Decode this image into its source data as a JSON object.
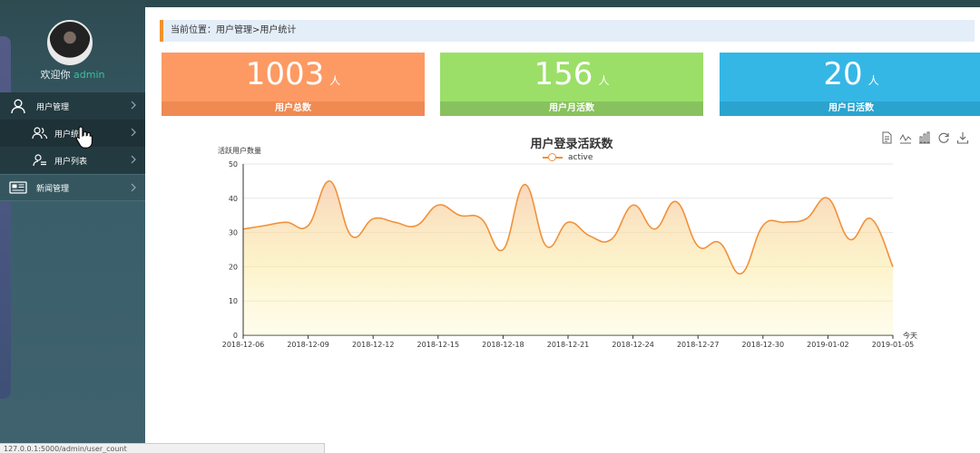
{
  "sidebar": {
    "welcome_prefix": "欢迎你",
    "username": "admin",
    "menu": [
      {
        "label": "用户管理",
        "icon": "user-icon"
      },
      {
        "label": "用户统",
        "icon": "users-icon"
      },
      {
        "label": "用户列表",
        "icon": "user-list-icon"
      },
      {
        "label": "新闻管理",
        "icon": "news-icon"
      }
    ]
  },
  "statusbar": {
    "url": "127.0.0.1:5000/admin/user_count"
  },
  "breadcrumb": {
    "text": "当前位置：用户管理>用户统计"
  },
  "cards": [
    {
      "value": "1003",
      "unit": "人",
      "label": "用户总数",
      "color": "#fd9a63"
    },
    {
      "value": "156",
      "unit": "人",
      "label": "用户月活数",
      "color": "#9bdf68"
    },
    {
      "value": "20",
      "unit": "人",
      "label": "用户日活数",
      "color": "#35b7e6"
    }
  ],
  "toolbox": [
    "data-view-icon",
    "line-switch-icon",
    "bar-switch-icon",
    "restore-icon",
    "download-icon"
  ],
  "chart_data": {
    "type": "area",
    "title": "用户登录活跃数",
    "ylabel": "活跃用户数量",
    "xlabel": "今天",
    "ylim": [
      0,
      50
    ],
    "yticks": [
      0,
      10,
      20,
      30,
      40,
      50
    ],
    "legend": "top-center",
    "grid": true,
    "color": "#f1913a",
    "x_tick_labels": [
      "2018-12-06",
      "2018-12-09",
      "2018-12-12",
      "2018-12-15",
      "2018-12-18",
      "2018-12-21",
      "2018-12-24",
      "2018-12-27",
      "2018-12-30",
      "2019-01-02",
      "2019-01-05"
    ],
    "x": [
      "2018-12-06",
      "2018-12-07",
      "2018-12-08",
      "2018-12-09",
      "2018-12-10",
      "2018-12-11",
      "2018-12-12",
      "2018-12-13",
      "2018-12-14",
      "2018-12-15",
      "2018-12-16",
      "2018-12-17",
      "2018-12-18",
      "2018-12-19",
      "2018-12-20",
      "2018-12-21",
      "2018-12-22",
      "2018-12-23",
      "2018-12-24",
      "2018-12-25",
      "2018-12-26",
      "2018-12-27",
      "2018-12-28",
      "2018-12-29",
      "2018-12-30",
      "2018-12-31",
      "2019-01-01",
      "2019-01-02",
      "2019-01-03",
      "2019-01-04",
      "2019-01-05"
    ],
    "series": [
      {
        "name": "active",
        "values": [
          31,
          32,
          33,
          32,
          45,
          29,
          34,
          33,
          32,
          38,
          35,
          34,
          25,
          44,
          26,
          33,
          29,
          28,
          38,
          31,
          39,
          26,
          27,
          18,
          32,
          33,
          34,
          40,
          28,
          34,
          20
        ]
      }
    ]
  }
}
